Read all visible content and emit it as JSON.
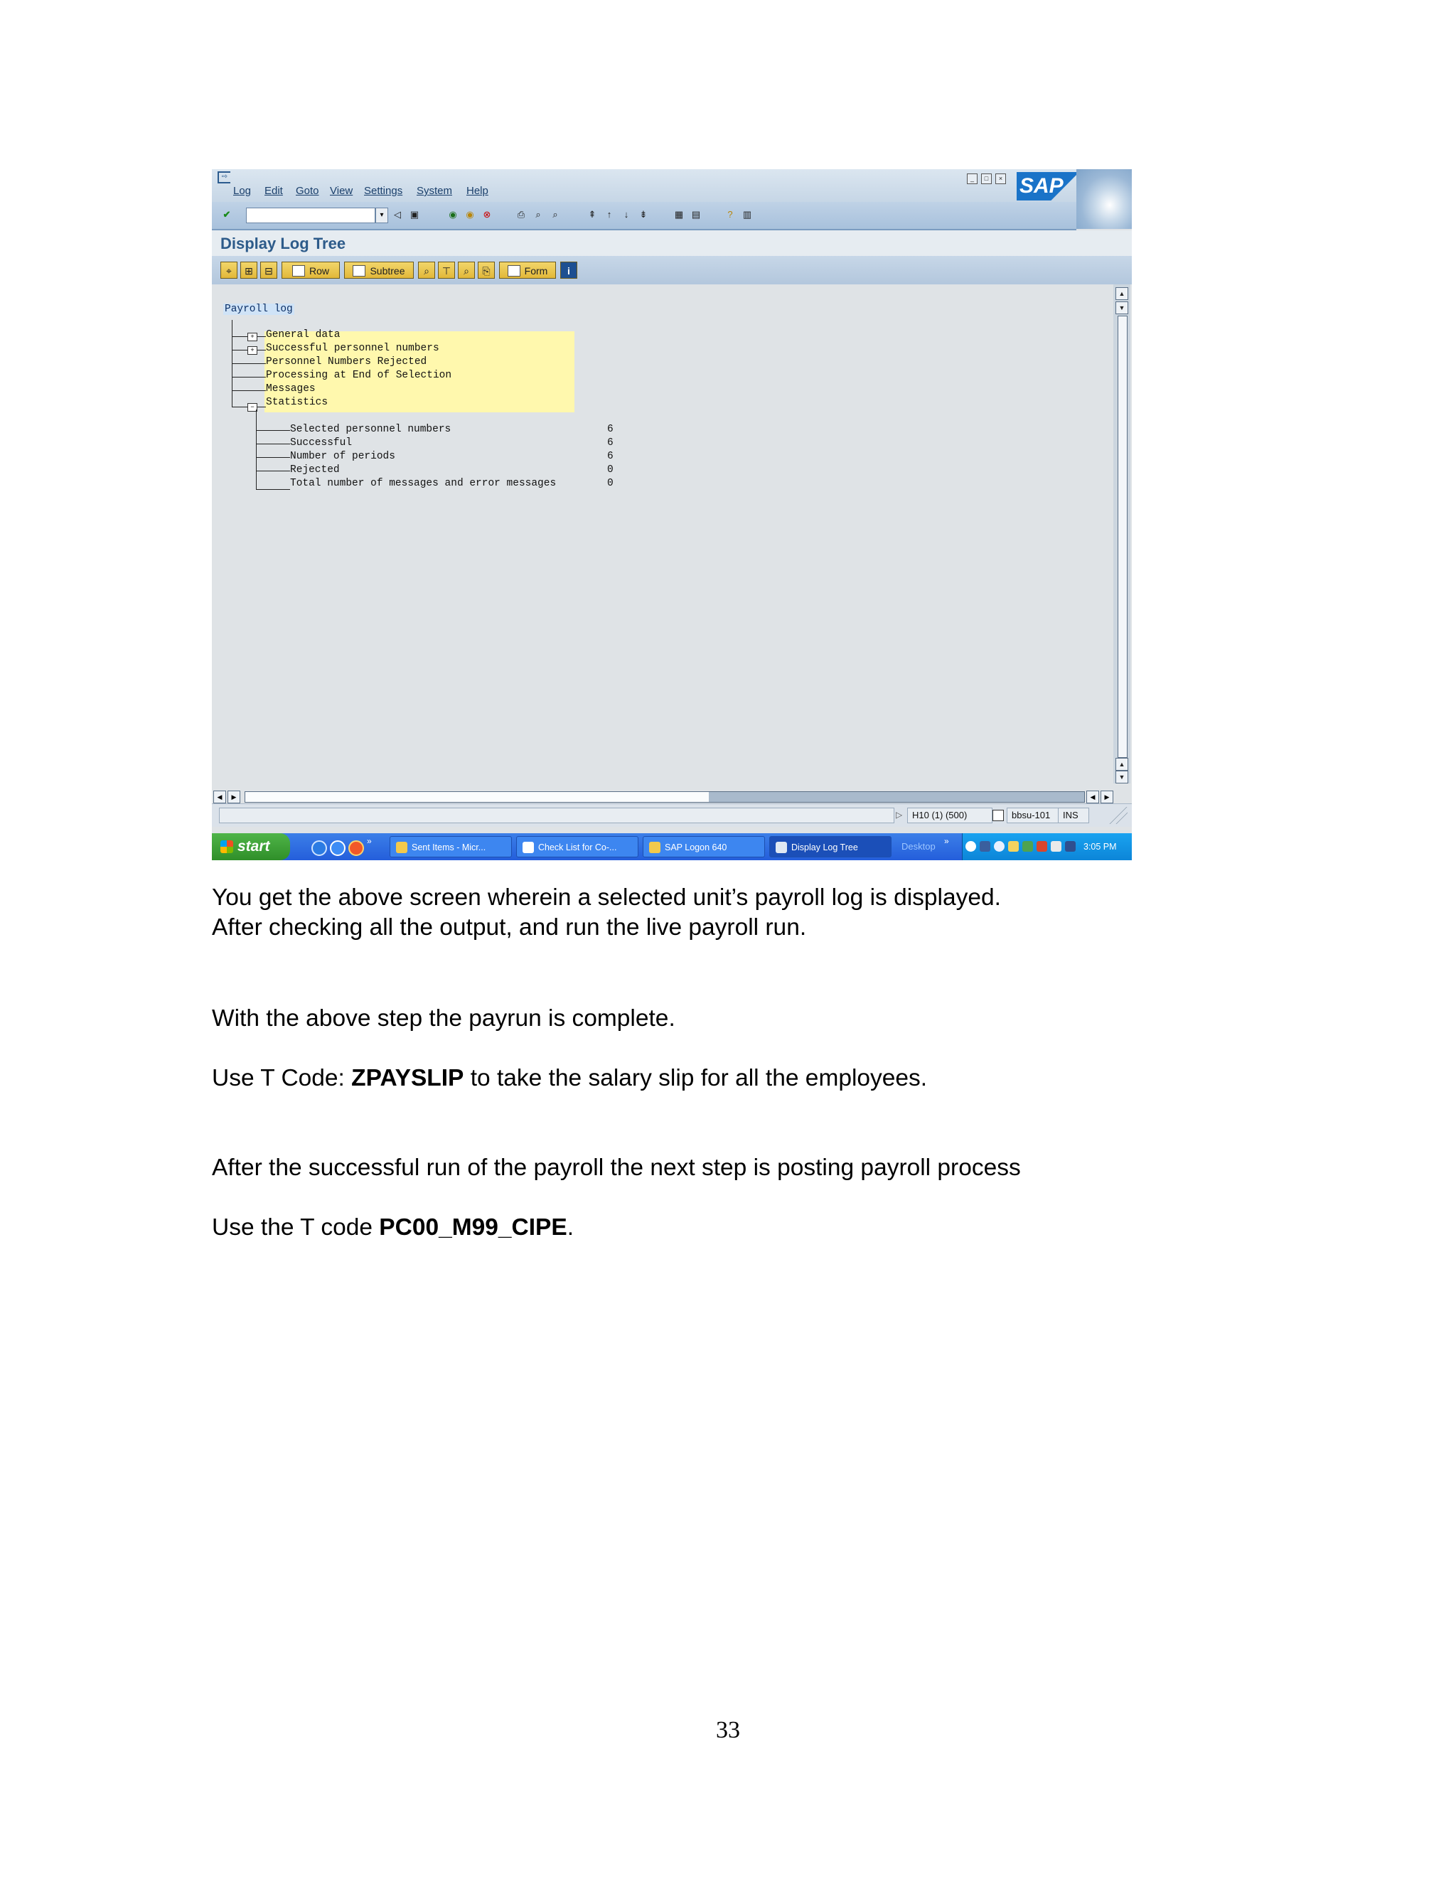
{
  "sap": {
    "menu": [
      "Log",
      "Edit",
      "Goto",
      "View",
      "Settings",
      "System",
      "Help"
    ],
    "logo_text": "SAP",
    "screen_title": "Display Log Tree",
    "app_buttons": {
      "row": "Row",
      "subtree": "Subtree",
      "form": "Form"
    },
    "tree": {
      "root": "Payroll log",
      "nodes": [
        "General data",
        "Successful personnel numbers",
        "Personnel Numbers Rejected",
        "Processing at End of Selection",
        "Messages",
        "Statistics"
      ],
      "statistics": [
        {
          "label": "Selected personnel numbers",
          "value": "6"
        },
        {
          "label": "Successful",
          "value": "6"
        },
        {
          "label": "Number of periods",
          "value": "6"
        },
        {
          "label": "Rejected",
          "value": "0"
        },
        {
          "label": "Total number of messages and error messages",
          "value": "0"
        }
      ]
    },
    "status": {
      "system": "H10 (1) (500)",
      "server": "bbsu-101",
      "mode": "INS"
    }
  },
  "taskbar": {
    "start": "start",
    "tasks": [
      "Sent Items - Micr...",
      "Check List for Co-...",
      "SAP Logon 640",
      "Display Log Tree"
    ],
    "desktop": "Desktop",
    "clock": "3:05 PM"
  },
  "doc": {
    "p1_line1": "You get the above screen wherein a selected unit’s payroll log is displayed.",
    "p1_line2": "After checking all the output, and run the live payroll run.",
    "p2": "With the above step the payrun is complete.",
    "p3_pre": "Use T Code: ",
    "p3_code": "ZPAYSLIP",
    "p3_post": " to take the salary slip for all the employees.",
    "p4": "After the successful run of the payroll the next step is posting payroll process",
    "p5_pre": "Use the T code ",
    "p5_code": "PC00_M99_CIPE",
    "p5_post": ".",
    "page_number": "33"
  },
  "colors": {
    "sap_title": "#2d5b8a",
    "highlight": "#fff8ad",
    "taskbar": "#245edb",
    "start": "#2f8f29"
  }
}
